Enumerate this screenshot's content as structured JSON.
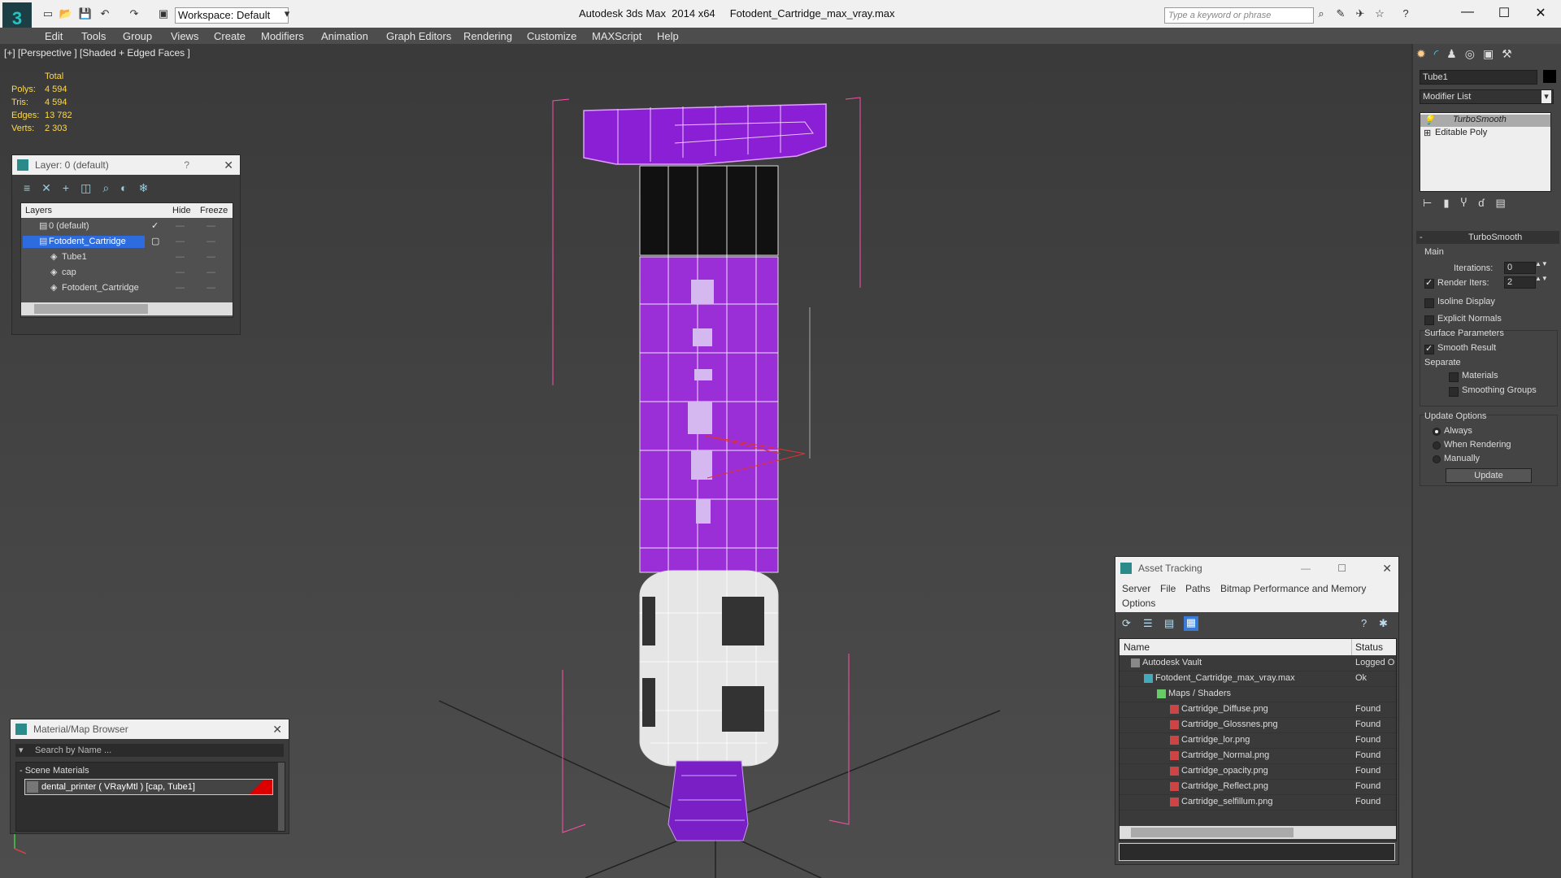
{
  "app": {
    "title": "Autodesk 3ds Max  2014 x64     Fotodent_Cartridge_max_vray.max",
    "workspace": "Workspace: Default",
    "search_placeholder": "Type a keyword or phrase"
  },
  "menu": [
    "Edit",
    "Tools",
    "Group",
    "Views",
    "Create",
    "Modifiers",
    "Animation",
    "Graph Editors",
    "Rendering",
    "Customize",
    "MAXScript",
    "Help"
  ],
  "viewport": {
    "label": "[+] [Perspective ] [Shaded + Edged Faces ]",
    "stats": {
      "header": "Total",
      "rows": [
        {
          "label": "Polys:",
          "value": "4 594"
        },
        {
          "label": "Tris:",
          "value": "4 594"
        },
        {
          "label": "Edges:",
          "value": "13 782"
        },
        {
          "label": "Verts:",
          "value": "2 303"
        }
      ]
    }
  },
  "layer_panel": {
    "title": "Layer: 0 (default)",
    "help": "?",
    "columns": [
      "Layers",
      "Hide",
      "Freeze"
    ],
    "rows": [
      {
        "name": "0 (default)",
        "indent": 1
      },
      {
        "name": "Fotodent_Cartridge",
        "indent": 1
      },
      {
        "name": "Tube1",
        "indent": 2
      },
      {
        "name": "cap",
        "indent": 2
      },
      {
        "name": "Fotodent_Cartridge",
        "indent": 2
      }
    ]
  },
  "material_browser": {
    "title": "Material/Map Browser",
    "search_placeholder": "Search by Name ...",
    "section": "- Scene Materials",
    "item": "dental_printer  ( VRayMtl ) [cap, Tube1]"
  },
  "asset_tracking": {
    "title": "Asset Tracking",
    "menu": [
      "Server",
      "File",
      "Paths",
      "Bitmap Performance and Memory",
      "Options"
    ],
    "columns": [
      "Name",
      "Status"
    ],
    "rows": [
      {
        "name": "Autodesk Vault",
        "status": "Logged O",
        "indent": 1
      },
      {
        "name": "Fotodent_Cartridge_max_vray.max",
        "status": "Ok",
        "indent": 2
      },
      {
        "name": "Maps / Shaders",
        "status": "",
        "indent": 3
      },
      {
        "name": "Cartridge_Diffuse.png",
        "status": "Found",
        "indent": 4
      },
      {
        "name": "Cartridge_Glossnes.png",
        "status": "Found",
        "indent": 4
      },
      {
        "name": "Cartridge_lor.png",
        "status": "Found",
        "indent": 4
      },
      {
        "name": "Cartridge_Normal.png",
        "status": "Found",
        "indent": 4
      },
      {
        "name": "Cartridge_opacity.png",
        "status": "Found",
        "indent": 4
      },
      {
        "name": "Cartridge_Reflect.png",
        "status": "Found",
        "indent": 4
      },
      {
        "name": "Cartridge_selfillum.png",
        "status": "Found",
        "indent": 4
      }
    ]
  },
  "command_panel": {
    "object_name": "Tube1",
    "modifier_list": "Modifier List",
    "stack": [
      "TurboSmooth",
      "Editable Poly"
    ],
    "rollout_title": "TurboSmooth",
    "main_label": "Main",
    "iterations_label": "Iterations:",
    "iterations_value": "0",
    "render_iters_label": "Render Iters:",
    "render_iters_value": "2",
    "isoline": "Isoline Display",
    "explicit_normals": "Explicit Normals",
    "surface_params": "Surface Parameters",
    "smooth_result": "Smooth Result",
    "separate": "Separate",
    "materials": "Materials",
    "smoothing_groups": "Smoothing Groups",
    "update_options": "Update Options",
    "always": "Always",
    "when_rendering": "When Rendering",
    "manually": "Manually",
    "update_button": "Update"
  }
}
